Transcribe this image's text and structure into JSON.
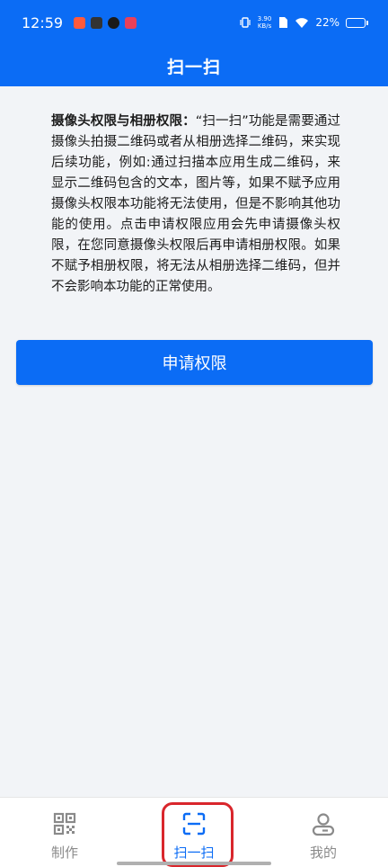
{
  "status": {
    "time": "12:59",
    "speed_value": "3.90",
    "speed_unit": "KB/s",
    "battery": "22%",
    "battery_fraction": 0.22
  },
  "header": {
    "title": "扫一扫"
  },
  "permission": {
    "bold_label": "摄像头权限与相册权限：",
    "text": "“扫一扫”功能是需要通过摄像头拍摄二维码或者从相册选择二维码，来实现后续功能，例如:通过扫描本应用生成二维码，来显示二维码包含的文本，图片等，如果不赋予应用摄像头权限本功能将无法使用，但是不影响其他功能的使用。点击申请权限应用会先申请摄像头权限，在您同意摄像头权限后再申请相册权限。如果不赋予相册权限，将无法从相册选择二维码，但并不会影响本功能的正常使用。"
  },
  "actions": {
    "apply_label": "申请权限"
  },
  "tabs": [
    {
      "label": "制作",
      "icon": "qr-code-icon",
      "active": false
    },
    {
      "label": "扫一扫",
      "icon": "scan-icon",
      "active": true
    },
    {
      "label": "我的",
      "icon": "user-icon",
      "active": false
    }
  ],
  "colors": {
    "primary": "#0b6cf5",
    "highlight": "#d9262c",
    "inactive": "#8a8a8a"
  }
}
